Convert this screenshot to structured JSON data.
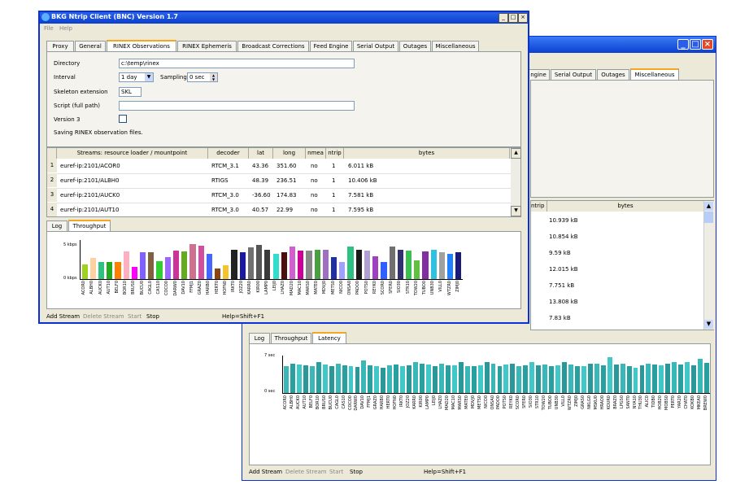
{
  "front": {
    "title": "BKG Ntrip Client (BNC) Version 1.7",
    "menu": [
      "File",
      "Help"
    ],
    "tabs": [
      "Proxy",
      "General",
      "RINEX Observations",
      "RINEX Ephemeris",
      "Broadcast Corrections",
      "Feed Engine",
      "Serial Output",
      "Outages",
      "Miscellaneous"
    ],
    "active_tab": "RINEX Observations",
    "form": {
      "directory_label": "Directory",
      "directory_value": "c:\\temp\\rinex",
      "interval_label": "Interval",
      "interval_value": "1 day",
      "sampling_label": "Sampling",
      "sampling_value": "0 sec",
      "skeleton_label": "Skeleton extension",
      "skeleton_value": "SKL",
      "script_label": "Script (full path)",
      "script_value": "",
      "version3_label": "Version 3",
      "note": "Saving RINEX observation files."
    },
    "table": {
      "columns": [
        "Streams:   resource loader / mountpoint",
        "decoder",
        "lat",
        "long",
        "nmea",
        "ntrip",
        "bytes"
      ],
      "rows": [
        {
          "n": "1",
          "mount": "euref-ip:2101/ACOR0",
          "decoder": "RTCM_3.1",
          "lat": "43.36",
          "long": "351.60",
          "nmea": "no",
          "ntrip": "1",
          "bytes": "6.011 kB"
        },
        {
          "n": "2",
          "mount": "euref-ip:2101/ALBH0",
          "decoder": "RTIGS",
          "lat": "48.39",
          "long": "236.51",
          "nmea": "no",
          "ntrip": "1",
          "bytes": "10.406 kB"
        },
        {
          "n": "3",
          "mount": "euref-ip:2101/AUCK0",
          "decoder": "RTCM_3.0",
          "lat": "-36.60",
          "long": "174.83",
          "nmea": "no",
          "ntrip": "1",
          "bytes": "7.581 kB"
        },
        {
          "n": "4",
          "mount": "euref-ip:2101/AUT10",
          "decoder": "RTCM_3.0",
          "lat": "40.57",
          "long": "22.99",
          "nmea": "no",
          "ntrip": "1",
          "bytes": "7.595 kB"
        }
      ]
    },
    "log_tabs": [
      "Log",
      "Throughput"
    ],
    "log_active": "Throughput",
    "chart_data": {
      "type": "bar",
      "ytick_labels": [
        "5 kbps",
        "0 kbps"
      ],
      "categories": [
        "ACOR0",
        "ALBH0",
        "AUCK0",
        "AUT10",
        "BELF0",
        "BOR10",
        "BRUS0",
        "BUCU0",
        "CAGL0",
        "CAS10",
        "COCO0",
        "DARW0",
        "DAV10",
        "FFMJ1",
        "GRAZ0",
        "HARB0",
        "HERT0",
        "HOFN0",
        "IRKT0",
        "JOZ20",
        "KARR0",
        "KIR00",
        "LAMP0",
        "LEIJ0",
        "LHAZ0",
        "MAD20",
        "MAC10",
        "MARS0",
        "MATE0",
        "MDVJ0",
        "METS0",
        "NICO0",
        "ONSA0",
        "PADO0",
        "POTS0",
        "REYK0",
        "SCOR0",
        "SFER0",
        "SIO30",
        "STR10",
        "TOW20",
        "TUBO0",
        "UNB30",
        "VILL0",
        "WTZR0",
        "ZIMJ0"
      ],
      "values": [
        1.9,
        2.7,
        2.2,
        2.2,
        2.2,
        3.5,
        1.6,
        3.4,
        3.4,
        2.3,
        2.8,
        3.6,
        3.5,
        4.5,
        4.3,
        3.2,
        1.4,
        1.8,
        3.7,
        3.4,
        4.1,
        4.4,
        3.8,
        3.2,
        3.4,
        4.2,
        3.6,
        3.6,
        3.8,
        3.8,
        2.8,
        2.2,
        4.2,
        3.7,
        3.6,
        2.9,
        2.2,
        4.2,
        3.7,
        3.6,
        2.4,
        3.5,
        3.8,
        3.4,
        3.2,
        3.4
      ],
      "colors": [
        "#a0d020",
        "#ffd0a0",
        "#30c080",
        "#22aa22",
        "#ff7f00",
        "#ffb0c0",
        "#ff00ff",
        "#8060ff",
        "#806040",
        "#33cc33",
        "#9966ff",
        "#cc3399",
        "#66aa22",
        "#d07090",
        "#d050a0",
        "#4466ff",
        "#8b4513",
        "#f4c430",
        "#222222",
        "#1a1aa0",
        "#707070",
        "#555555",
        "#3a3a3a",
        "#33ddcc",
        "#4a1010",
        "#d060d0",
        "#cc0099",
        "#888888",
        "#4aa040",
        "#a070c0",
        "#2030a0",
        "#a0a0ff",
        "#2dc080",
        "#1a1a1a",
        "#b0a0d0",
        "#a040c0",
        "#3060ff",
        "#707070",
        "#303070",
        "#3ac050",
        "#60c040",
        "#8030a0",
        "#30c0e0",
        "#a0a0a0",
        "#2080ff",
        "#1a1a7a"
      ]
    },
    "status": {
      "add": "Add Stream",
      "delete": "Delete Stream",
      "start": "Start",
      "stop": "Stop",
      "help": "Help=Shift+F1"
    }
  },
  "back": {
    "tabs": [
      "ngine",
      "Serial Output",
      "Outages",
      "Miscellaneous"
    ],
    "active_tab": "Miscellaneous",
    "table_headers": [
      "ntrip",
      "bytes"
    ],
    "bytes": [
      "10.939 kB",
      "10.854 kB",
      "9.59 kB",
      "12.015 kB",
      "7.751 kB",
      "13.808 kB",
      "7.83 kB"
    ],
    "log_tabs": [
      "Log",
      "Throughput",
      "Latency"
    ],
    "log_active": "Latency",
    "chart_data": {
      "type": "bar",
      "ytick_labels": [
        "7 sec",
        "0 sec"
      ],
      "categories": [
        "ACOR0",
        "ALBH0",
        "AUCK0",
        "AUT10",
        "BELF0",
        "BOR10",
        "BRUS0",
        "BUCU0",
        "CAGL0",
        "CAS10",
        "COCO0",
        "DARW0",
        "DAV10",
        "FFMJ1",
        "GRAZ0",
        "HARB0",
        "HERT0",
        "HOFN0",
        "IRKT0",
        "JOZ20",
        "KARR0",
        "KIR00",
        "LAMP0",
        "LEIJ0",
        "LHAZ0",
        "MAD20",
        "MAC10",
        "MARS0",
        "MATE0",
        "MDVJ0",
        "METS0",
        "NICO0",
        "ONSA0",
        "PADO0",
        "POTS0",
        "REYK0",
        "SCOR0",
        "SFER0",
        "SIO30",
        "STR10",
        "TOW20",
        "TUBO0",
        "UNB30",
        "VILL0",
        "WTZR0",
        "ZIMJ0",
        "GRAS0",
        "NKLG0",
        "MSKU0",
        "HRAO0",
        "KOUR0",
        "BRAZ0",
        "LPGS0",
        "SANT0",
        "NYA10",
        "THU30",
        "ALIC0",
        "TIDB0",
        "HOB20",
        "MOBS0",
        "PERT0",
        "YAR20",
        "CHAT0",
        "KOKB0",
        "MKEA0",
        "BREW0"
      ],
      "values": [
        5.5,
        6.0,
        5.8,
        5.6,
        5.4,
        6.3,
        5.8,
        5.5,
        6.0,
        5.6,
        5.4,
        5.3,
        6.6,
        5.7,
        5.4,
        5.2,
        5.6,
        5.8,
        5.4,
        5.6,
        6.3,
        6.0,
        5.8,
        5.4,
        6.0,
        5.7,
        5.6,
        6.2,
        5.5,
        5.4,
        5.6,
        6.2,
        5.9,
        5.5,
        5.8,
        6.0,
        5.4,
        5.6,
        6.3,
        5.6,
        5.8,
        5.4,
        5.6,
        6.3,
        5.8,
        5.4,
        5.5,
        6.0,
        5.9,
        5.6,
        7.3,
        5.8,
        6.0,
        5.4,
        5.2,
        5.6,
        6.0,
        5.8,
        5.7,
        5.9,
        6.2,
        5.8,
        6.3,
        5.7,
        6.9,
        6.1
      ],
      "colors": [
        "#3ab8b8",
        "#28a0a0",
        "#40c8c8",
        "#2a9898"
      ]
    },
    "status": {
      "add": "Add Stream",
      "delete": "Delete Stream",
      "start": "Start",
      "stop": "Stop",
      "help": "Help=Shift+F1"
    }
  }
}
